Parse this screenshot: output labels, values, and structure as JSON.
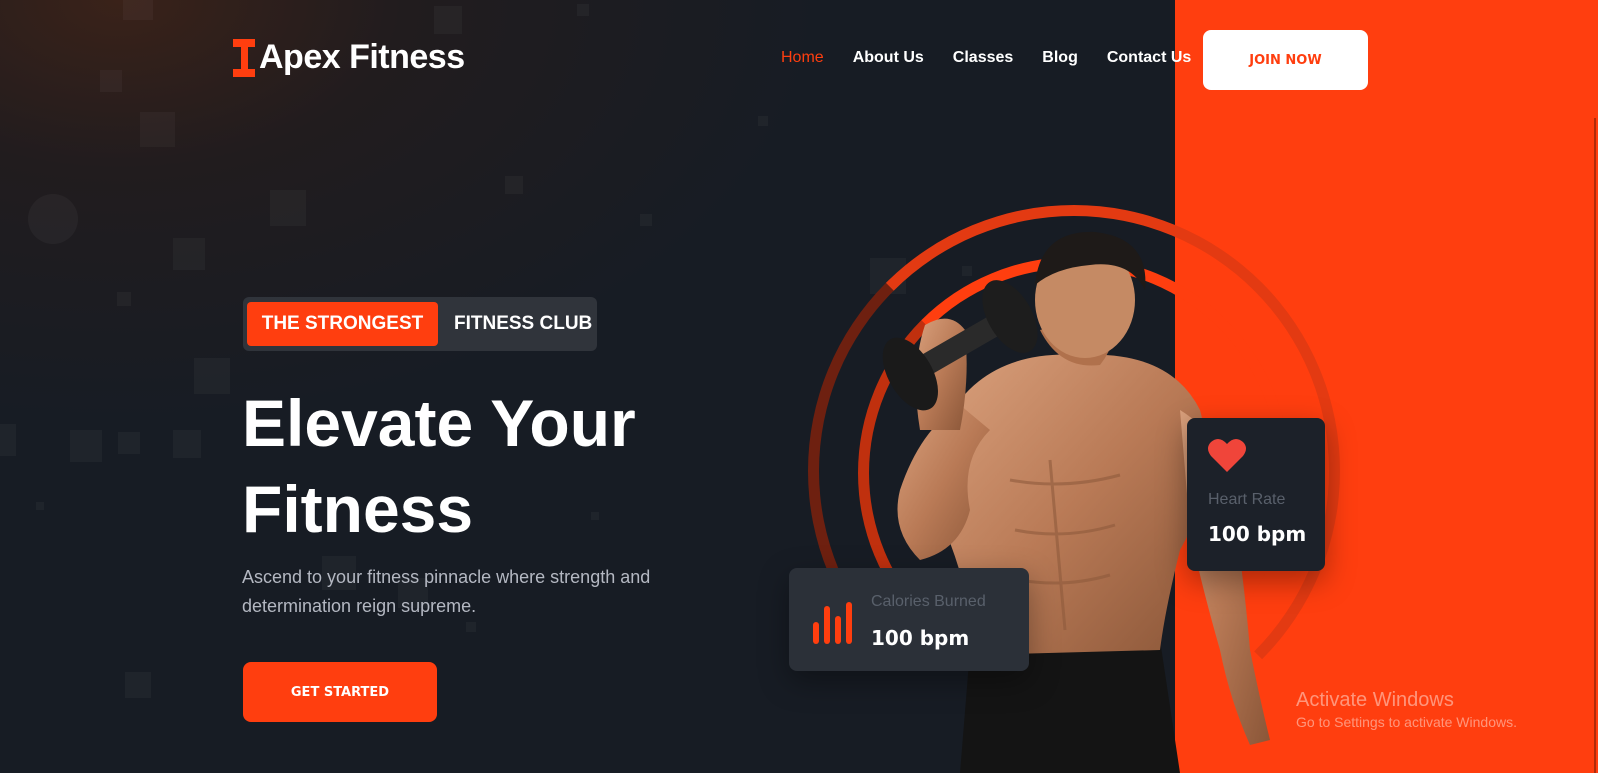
{
  "brand": {
    "name": "Apex Fitness",
    "icon": "dumbbell-icon",
    "accent": "#ff3e0f"
  },
  "nav": {
    "items": [
      {
        "label": "Home",
        "active": true
      },
      {
        "label": "About Us"
      },
      {
        "label": "Classes"
      },
      {
        "label": "Blog"
      },
      {
        "label": "Contact Us"
      }
    ],
    "join_label": "JOIN NOW"
  },
  "hero": {
    "tag_highlight": "THE STRONGEST",
    "tag_rest": "FITNESS CLUB",
    "headline_line1": "Elevate Your",
    "headline_line2": "Fitness",
    "subtext_line1": "Ascend to your fitness pinnacle where strength and",
    "subtext_line2": "determination reign supreme.",
    "cta_label": "GET STARTED"
  },
  "stats": {
    "calories": {
      "label": "Calories Burned",
      "value": "100 bpm",
      "icon": "bar-chart-icon"
    },
    "heart": {
      "label": "Heart Rate",
      "value": "100 bpm",
      "icon": "heart-icon"
    }
  },
  "watermark": {
    "title": "Activate Windows",
    "subtitle": "Go to Settings to activate Windows."
  },
  "colors": {
    "background": "#171c24",
    "panel": "#ff3e0f",
    "card": "#2b3038"
  }
}
